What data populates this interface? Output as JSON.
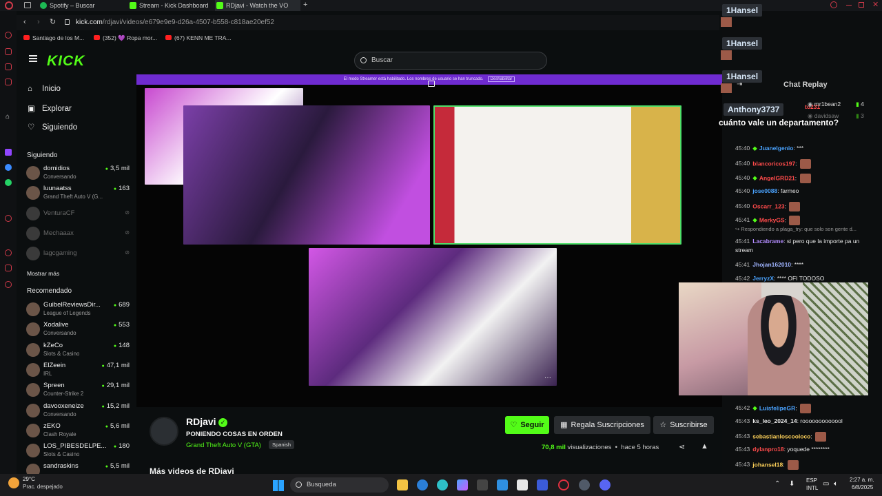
{
  "browser": {
    "tabs": [
      {
        "label": "Spotify – Buscar",
        "color": "#1db954"
      },
      {
        "label": "Stream - Kick Dashboard",
        "color": "#53fc18"
      },
      {
        "label": "RDjavi - Watch the VO",
        "color": "#53fc18"
      }
    ],
    "url_host": "kick.com",
    "url_path": "/rdjavi/videos/e679e9e9-d26a-4507-b558-c818ae20ef52",
    "bookmarks": [
      "Santiago de los M...",
      "(352) 💜 Ropa mor...",
      "(67) KENN ME TRA..."
    ]
  },
  "kick": {
    "logo": "KICK",
    "search_placeholder": "Buscar",
    "nav": [
      {
        "label": "Inicio",
        "icon": "home-icon"
      },
      {
        "label": "Explorar",
        "icon": "explore-icon"
      },
      {
        "label": "Siguiendo",
        "icon": "heart-icon"
      }
    ],
    "following_title": "Siguiendo",
    "following": [
      {
        "name": "domidios",
        "sub": "Conversando",
        "viewers": "3,5 mil"
      },
      {
        "name": "luunaatss",
        "sub": "Grand Theft Auto V (G...",
        "viewers": "163"
      },
      {
        "name": "VenturaCF",
        "sub": "",
        "viewers": ""
      },
      {
        "name": "Mechaaax",
        "sub": "",
        "viewers": ""
      },
      {
        "name": "lagcgaming",
        "sub": "",
        "viewers": ""
      }
    ],
    "show_more": "Mostrar más",
    "recommended_title": "Recomendado",
    "recommended": [
      {
        "name": "GuibelReviewsDir...",
        "sub": "League of Legends",
        "viewers": "689"
      },
      {
        "name": "Xodalive",
        "sub": "Conversando",
        "viewers": "553"
      },
      {
        "name": "kZeCo",
        "sub": "Slots & Casino",
        "viewers": "148"
      },
      {
        "name": "ElZeein",
        "sub": "IRL",
        "viewers": "47,1 mil"
      },
      {
        "name": "Spreen",
        "sub": "Counter-Strike 2",
        "viewers": "29,1 mil"
      },
      {
        "name": "davooxeneize",
        "sub": "Conversando",
        "viewers": "15,2 mil"
      },
      {
        "name": "zEKO",
        "sub": "Clash Royale",
        "viewers": "5,6 mil"
      },
      {
        "name": "LOS_PIBESDELPE...",
        "sub": "Slots & Casino",
        "viewers": "180"
      },
      {
        "name": "sandraskins",
        "sub": "",
        "viewers": "5,5 mil"
      }
    ],
    "banner_text": "El modo Streamer está habilitado. Los nombres de usuario se han truncado.",
    "banner_button": "Deshabilitar",
    "channel": {
      "name": "RDjavi",
      "title": "PONIENDO COSAS EN ORDEN",
      "category": "Grand Theft Auto V (GTA)",
      "language": "Spanish",
      "views": "70,8 mil",
      "views_label": "visualizaciones",
      "time_ago": "hace 5 horas"
    },
    "buttons": {
      "follow": "Seguir",
      "gift": "Regala Suscripciones",
      "subscribe": "Suscribirse"
    },
    "more_videos": "Más videos de RDjavi"
  },
  "overlay": {
    "names": [
      "1Hansel",
      "1Hansel",
      "1Hansel"
    ],
    "alert_user": "Anthony3737",
    "alert_msg": "cuánto vale un departamento?"
  },
  "chat": {
    "title": "Chat Replay",
    "top_users": [
      {
        "name": "mr1bean2",
        "count": "4"
      },
      {
        "name": "davidsaw",
        "count": "3"
      }
    ],
    "partial_user": "to231",
    "reply_context": "Respondiendo a plaga_try: que solo son gente d...",
    "messages": [
      {
        "time": "45:40",
        "user": "Juanelgenio",
        "color": "#4aa3ff",
        "text": "***",
        "emote": false,
        "badge": true
      },
      {
        "time": "45:40",
        "user": "blancoricos197",
        "color": "#ff4b4b",
        "text": "",
        "emote": true,
        "badge": false
      },
      {
        "time": "45:40",
        "user": "AngelGRD21",
        "color": "#ff4b4b",
        "text": "",
        "emote": true,
        "badge": true
      },
      {
        "time": "45:40",
        "user": "jose0088",
        "color": "#4aa3ff",
        "text": "farmeo",
        "emote": false,
        "badge": false
      },
      {
        "time": "45:40",
        "user": "Oscarr_123",
        "color": "#ff4b4b",
        "text": "",
        "emote": true,
        "badge": false
      },
      {
        "time": "45:41",
        "user": "MerkyGS",
        "color": "#ff4b4b",
        "text": "",
        "emote": true,
        "badge": true
      },
      {
        "time": "45:41",
        "user": "Lacabrame",
        "color": "#b38cff",
        "text": "si pero que la importe pa un",
        "emote": false,
        "badge": false
      },
      {
        "time": "",
        "user": "",
        "color": "#e6e6e6",
        "text": "stream",
        "emote": false,
        "badge": false
      },
      {
        "time": "45:41",
        "user": "Jhojan162010",
        "color": "#9fb4ff",
        "text": "****",
        "emote": false,
        "badge": false
      },
      {
        "time": "45:42",
        "user": "JerryzX",
        "color": "#4aa3ff",
        "text": "**** OFI TODOSO",
        "emote": false,
        "badge": false
      },
      {
        "time": "45:42",
        "user": "LuisfelipeGR",
        "color": "#4aa3ff",
        "text": "",
        "emote": true,
        "badge": true
      },
      {
        "time": "45:43",
        "user": "ks_leo_2024_14",
        "color": "#e6e6e6",
        "text": "rooooooooooool",
        "emote": false,
        "badge": false
      },
      {
        "time": "45:43",
        "user": "sebastianloscooloco",
        "color": "#ffd25a",
        "text": "",
        "emote": true,
        "badge": false
      },
      {
        "time": "45:43",
        "user": "dylanpro18",
        "color": "#ff4b4b",
        "text": "yoquede ********",
        "emote": false,
        "badge": false
      },
      {
        "time": "45:43",
        "user": "johansel18",
        "color": "#ffd25a",
        "text": "",
        "emote": true,
        "badge": false
      }
    ]
  },
  "taskbar": {
    "temp": "29°C",
    "weather": "Prac. despejado",
    "search_placeholder": "Busqueda",
    "lang_top": "ESP",
    "lang_bottom": "INTL",
    "time": "2:27 a. m.",
    "date": "6/8/2025"
  }
}
